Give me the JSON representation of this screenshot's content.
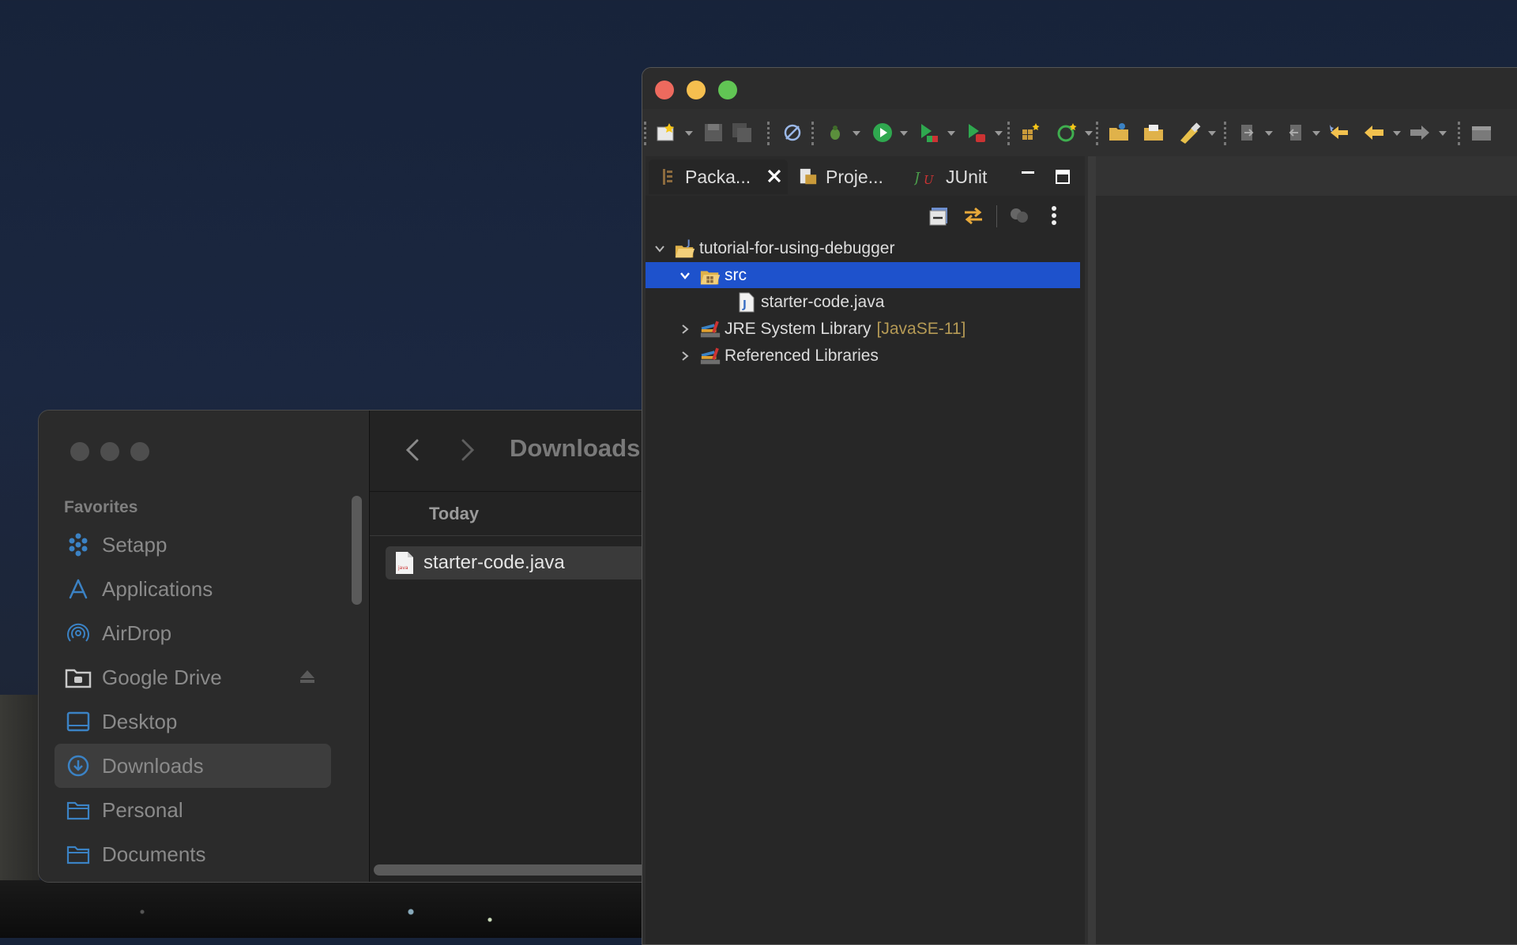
{
  "finder": {
    "title": "Downloads",
    "favorites_title": "Favorites",
    "sidebar_items": [
      {
        "label": "Setapp",
        "icon": "setapp-icon"
      },
      {
        "label": "Applications",
        "icon": "applications-icon"
      },
      {
        "label": "AirDrop",
        "icon": "airdrop-icon"
      },
      {
        "label": "Google Drive",
        "icon": "drive-folder-icon"
      },
      {
        "label": "Desktop",
        "icon": "desktop-icon"
      },
      {
        "label": "Downloads",
        "icon": "downloads-icon"
      },
      {
        "label": "Personal",
        "icon": "folder-icon"
      },
      {
        "label": "Documents",
        "icon": "folder-icon"
      }
    ],
    "section_header": "Today",
    "file": {
      "name": "starter-code.java",
      "icon": "java-file-icon"
    }
  },
  "eclipse": {
    "tabs": [
      {
        "label": "Packa...",
        "icon": "package-explorer-icon"
      },
      {
        "label": "Proje...",
        "icon": "project-explorer-icon"
      },
      {
        "label": "JUnit",
        "icon": "junit-icon"
      }
    ],
    "tree": {
      "project": "tutorial-for-using-debugger",
      "src": "src",
      "file": "starter-code.java",
      "jre": "JRE System Library",
      "jre_decor": "[JavaSE-11]",
      "ref_libs": "Referenced Libraries"
    }
  },
  "colors": {
    "selection": "#1e52cc",
    "accent_blue": "#3b82c4",
    "decor": "#b59a55"
  }
}
